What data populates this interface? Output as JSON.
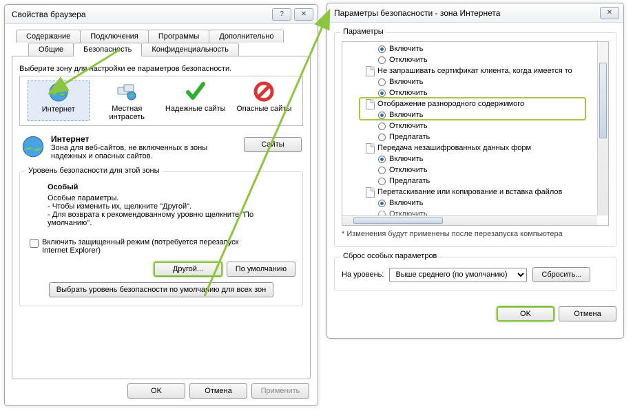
{
  "left": {
    "title": "Свойства браузера",
    "tabs_row1": [
      "Содержание",
      "Подключения",
      "Программы",
      "Дополнительно"
    ],
    "tabs_row2": [
      "Общие",
      "Безопасность",
      "Конфиденциальность"
    ],
    "selected_tab": "Безопасность",
    "zone_prompt": "Выберите зону для настройки ее параметров безопасности.",
    "zones": {
      "internet": "Интернет",
      "intranet": "Местная интрасеть",
      "trusted": "Надежные сайты",
      "restricted": "Опасные сайты"
    },
    "zone_info": {
      "title": "Интернет",
      "desc": "Зона для веб-сайтов, не включенных в зоны надежных и опасных сайтов.",
      "sites_btn": "Сайты"
    },
    "level_group": "Уровень безопасности для этой зоны",
    "level": {
      "name": "Особый",
      "l1": "Особые параметры.",
      "l2": "- Чтобы изменить их, щелкните \"Другой\".",
      "l3": "- Для возврата к рекомендованному уровню щелкните \"По умолчанию\"."
    },
    "protected_mode": "Включить защищенный режим (потребуется перезапуск Internet Explorer)",
    "btn_custom": "Другой...",
    "btn_default": "По умолчанию",
    "btn_reset_all": "Выбрать уровень безопасности по умолчанию для всех зон",
    "ok": "OK",
    "cancel": "Отмена",
    "apply": "Применить"
  },
  "right": {
    "title": "Параметры безопасности - зона Интернета",
    "group_settings": "Параметры",
    "opts": {
      "enable": "Включить",
      "disable": "Отключить",
      "prompt": "Предлагать"
    },
    "grp_cert": "Не запрашивать сертификат клиента, когда имеется то",
    "grp_mixed": "Отображение разнородного содержимого",
    "grp_forms": "Передача незашифрованных данных форм",
    "grp_drag": "Перетаскивание или копирование и вставка файлов",
    "restart_note": "* Изменения будут применены после перезапуска компьютера",
    "group_reset": "Сброс особых параметров",
    "reset_label": "На уровень:",
    "reset_value": "Выше среднего (по умолчанию)",
    "reset_btn": "Сбросить...",
    "ok": "OK",
    "cancel": "Отмена"
  }
}
